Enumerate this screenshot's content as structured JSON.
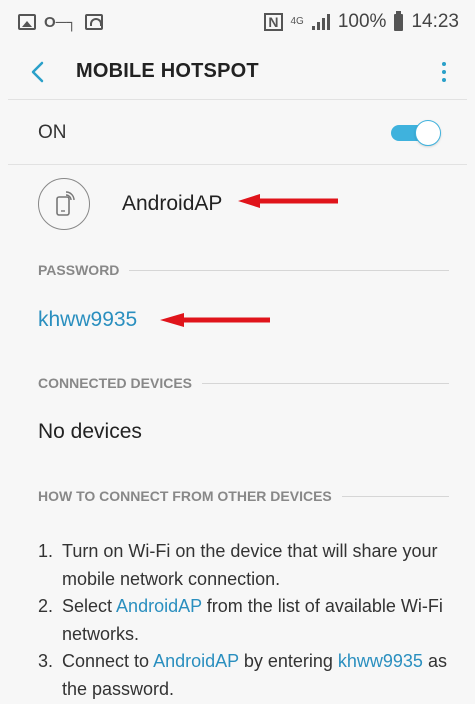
{
  "status_bar": {
    "battery": "100%",
    "time": "14:23",
    "network_type": "4G",
    "nfc_label": "N"
  },
  "header": {
    "title": "MOBILE HOTSPOT",
    "back_icon": "chevron-left-icon",
    "more_icon": "more-vertical-icon"
  },
  "toggle": {
    "label": "ON",
    "state": true,
    "accent": "#3fb2dd"
  },
  "network": {
    "name": "AndroidAP",
    "icon": "hotspot-device-icon"
  },
  "password": {
    "header": "PASSWORD",
    "value": "khww9935"
  },
  "connected": {
    "header": "CONNECTED DEVICES",
    "empty_text": "No devices"
  },
  "how_to": {
    "header": "HOW TO CONNECT FROM OTHER DEVICES",
    "steps": [
      {
        "num": "1.",
        "parts": [
          "Turn on Wi-Fi on the device that will share your mobile network connection."
        ]
      },
      {
        "num": "2.",
        "pre": "Select ",
        "link": "AndroidAP",
        "post": " from the list of available Wi-Fi networks."
      },
      {
        "num": "3.",
        "pre": "Connect to ",
        "link": "AndroidAP",
        "mid": " by entering ",
        "link2": "khww9935",
        "post": " as the password."
      }
    ]
  },
  "colors": {
    "link": "#2a8fbf",
    "annotation_arrow": "#e0141b"
  }
}
